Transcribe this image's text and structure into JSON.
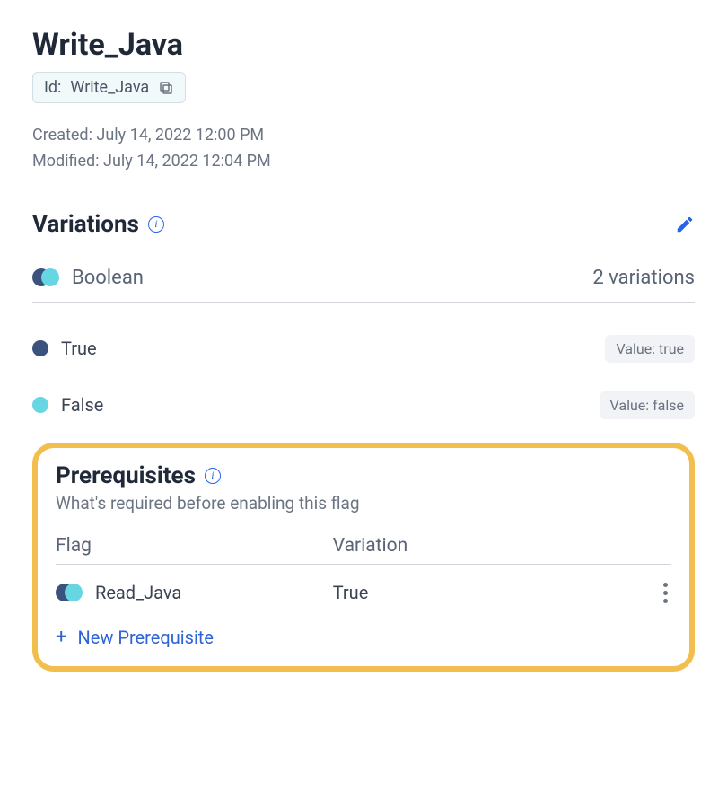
{
  "flag": {
    "title": "Write_Java",
    "id_label": "Id:",
    "id_value": "Write_Java",
    "created_label": "Created:",
    "created_value": "July 14, 2022 12:00 PM",
    "modified_label": "Modified:",
    "modified_value": "July 14, 2022 12:04 PM"
  },
  "variations": {
    "heading": "Variations",
    "type": "Boolean",
    "count_text": "2 variations",
    "items": [
      {
        "label": "True",
        "value_text": "Value: true"
      },
      {
        "label": "False",
        "value_text": "Value: false"
      }
    ]
  },
  "prerequisites": {
    "heading": "Prerequisites",
    "subheading": "What's required before enabling this flag",
    "columns": {
      "flag": "Flag",
      "variation": "Variation"
    },
    "rows": [
      {
        "flag": "Read_Java",
        "variation": "True"
      }
    ],
    "new_button": "New Prerequisite"
  }
}
